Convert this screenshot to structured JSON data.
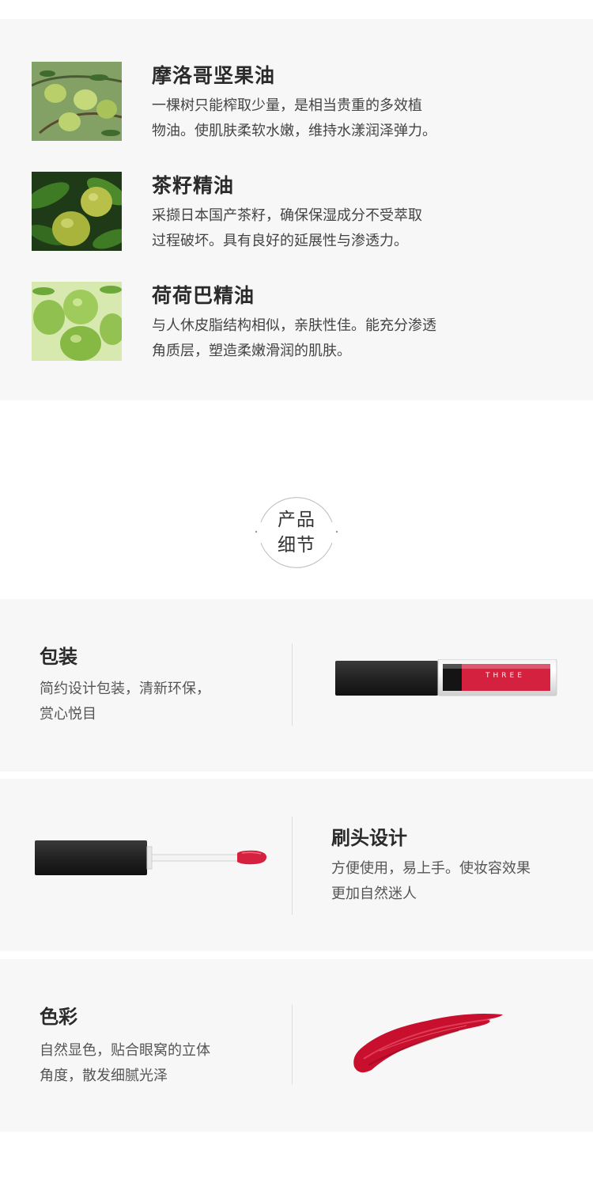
{
  "ingredients": [
    {
      "title": "摩洛哥坚果油",
      "desc_lines": [
        "一棵树只能榨取少量，是相当贵重的多效植",
        "物油。使肌肤柔软水嫩，维持水漾润泽弹力。"
      ],
      "image": "argan-fruit-photo"
    },
    {
      "title": "茶籽精油",
      "desc_lines": [
        "采撷日本国产茶籽，确保保湿成分不受萃取",
        "过程破坏。具有良好的延展性与渗透力。"
      ],
      "image": "tea-seed-photo"
    },
    {
      "title": "荷荷巴精油",
      "desc_lines": [
        "与人休皮脂结构相似，亲肤性佳。能充分渗透",
        "角质层，塑造柔嫩滑润的肌肤。"
      ],
      "image": "jojoba-fruit-photo"
    }
  ],
  "section_badge": {
    "line1": "产品",
    "line2": "细节"
  },
  "details": [
    {
      "title": "包装",
      "desc_lines": [
        "简约设计包装，清新环保，",
        "赏心悦目"
      ],
      "image": "closed-lip-tint-tube",
      "brand_text": "THREE"
    },
    {
      "title": "刷头设计",
      "desc_lines": [
        "方便使用，易上手。使妆容效果",
        "更加自然迷人"
      ],
      "image": "applicator-wand"
    },
    {
      "title": "色彩",
      "desc_lines": [
        "自然显色，贴合眼窝的立体",
        "角度，散发细腻光泽"
      ],
      "image": "red-color-swatch"
    }
  ],
  "colors": {
    "panel_bg": "#f7f7f7",
    "lip_red": "#d4213f",
    "cap_black": "#262626"
  }
}
